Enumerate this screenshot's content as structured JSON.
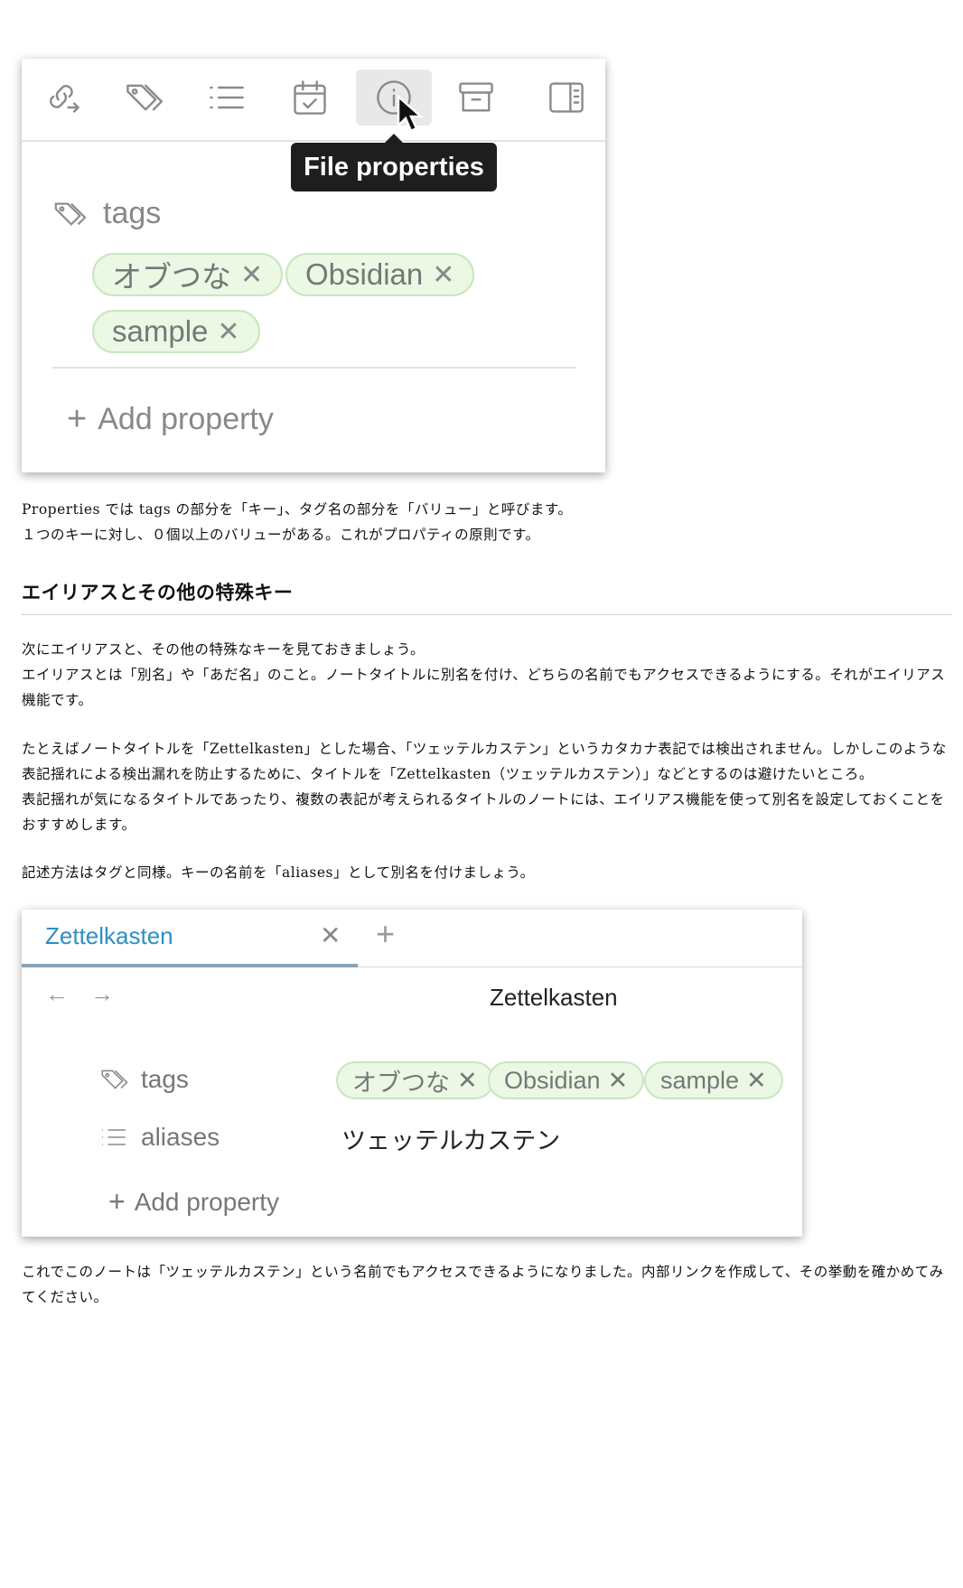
{
  "shot1": {
    "toolbar_icons": [
      "link-arrow-icon",
      "tags-icon",
      "list-icon",
      "calendar-check-icon",
      "info-icon",
      "archive-icon",
      "sidebar-icon"
    ],
    "tooltip": "File properties",
    "property_key": "tags",
    "chips": [
      "オブつな",
      "Obsidian",
      "sample"
    ],
    "chip_remove": "✕",
    "add_property": "Add property",
    "add_symbol": "+"
  },
  "text1": {
    "lines": [
      "Properties では tags の部分を「キー」、タグ名の部分を「バリュー」と呼びます。",
      "１つのキーに対し、０個以上のバリューがある。これがプロパティの原則です。"
    ]
  },
  "heading": "エイリアスとその他の特殊キー",
  "text2": {
    "lines": [
      "次にエイリアスと、その他の特殊なキーを見ておきましょう。",
      "エイリアスとは「別名」や「あだ名」のこと。ノートタイトルに別名を付け、どちらの名前でもアクセスできるようにする。それがエイリアス",
      "機能です。"
    ]
  },
  "text3": {
    "lines": [
      "たとえばノートタイトルを「Zettelkasten」とした場合、「ツェッテルカステン」というカタカナ表記では検出されません。しかしこのような",
      "表記揺れによる検出漏れを防止するために、タイトルを「Zettelkasten（ツェッテルカステン）」などとするのは避けたいところ。",
      "表記揺れが気になるタイトルであったり、複数の表記が考えられるタイトルのノートには、エイリアス機能を使って別名を設定しておくことを",
      "おすすめします。"
    ]
  },
  "text4": {
    "lines": [
      "記述方法はタグと同様。キーの名前を「aliases」として別名を付けましょう。"
    ]
  },
  "shot2": {
    "tab_title": "Zettelkasten",
    "tab_close": "✕",
    "tab_new": "+",
    "nav_back": "←",
    "nav_forward": "→",
    "note_title": "Zettelkasten",
    "tags_key": "tags",
    "aliases_key": "aliases",
    "chips": [
      "オブつな",
      "Obsidian",
      "sample"
    ],
    "chip_remove": "✕",
    "alias_value": "ツェッテルカステン",
    "add_property": "Add property",
    "add_symbol": "+"
  },
  "text5": {
    "lines": [
      "これでこのノートは「ツェッテルカステン」という名前でもアクセスできるようになりました。内部リンクを作成して、その挙動を確かめてみ",
      "てください。"
    ]
  }
}
